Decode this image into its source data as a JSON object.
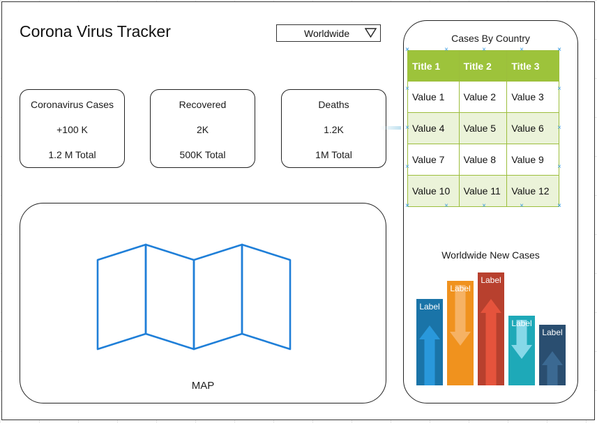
{
  "header": {
    "title": "Corona Virus Tracker",
    "region_select": {
      "value": "Worldwide",
      "icon": "triangle-down-icon"
    }
  },
  "stats": {
    "cases": {
      "title": "Coronavirus Cases",
      "new": "+100 K",
      "total": "1.2 M Total"
    },
    "recovered": {
      "title": "Recovered",
      "new": "2K",
      "total": "500K Total"
    },
    "deaths": {
      "title": "Deaths",
      "new": "1.2K",
      "total": "1M Total"
    }
  },
  "map": {
    "label": "MAP",
    "icon": "folded-map-icon",
    "color": "#1f7fd8"
  },
  "country_table": {
    "heading": "Cases By Country",
    "header_color": "#9dc33b",
    "columns": [
      "Title 1",
      "Title 2",
      "Title 3"
    ],
    "rows": [
      [
        "Value 1",
        "Value 2",
        "Value 3"
      ],
      [
        "Value 4",
        "Value 5",
        "Value 6"
      ],
      [
        "Value 7",
        "Value 8",
        "Value 9"
      ],
      [
        "Value 10",
        "Value 11",
        "Value 12"
      ]
    ]
  },
  "new_cases_chart": {
    "heading": "Worldwide New Cases"
  },
  "chart_data": {
    "type": "bar",
    "title": "Worldwide New Cases",
    "categories": [
      "Label",
      "Label",
      "Label",
      "Label",
      "Label"
    ],
    "values": [
      124,
      150,
      162,
      100,
      87
    ],
    "directions": [
      "up",
      "down",
      "up",
      "down",
      "up"
    ],
    "colors": [
      "#1a74a8",
      "#f0921e",
      "#b8402e",
      "#1ea9b8",
      "#2a4e70"
    ],
    "arrow_colors": [
      "#2a9be0",
      "#f6b56a",
      "#e8553e",
      "#8fdceb",
      "#3d6b95"
    ],
    "xlabel": "",
    "ylabel": "",
    "grid": false,
    "legend": "none"
  }
}
